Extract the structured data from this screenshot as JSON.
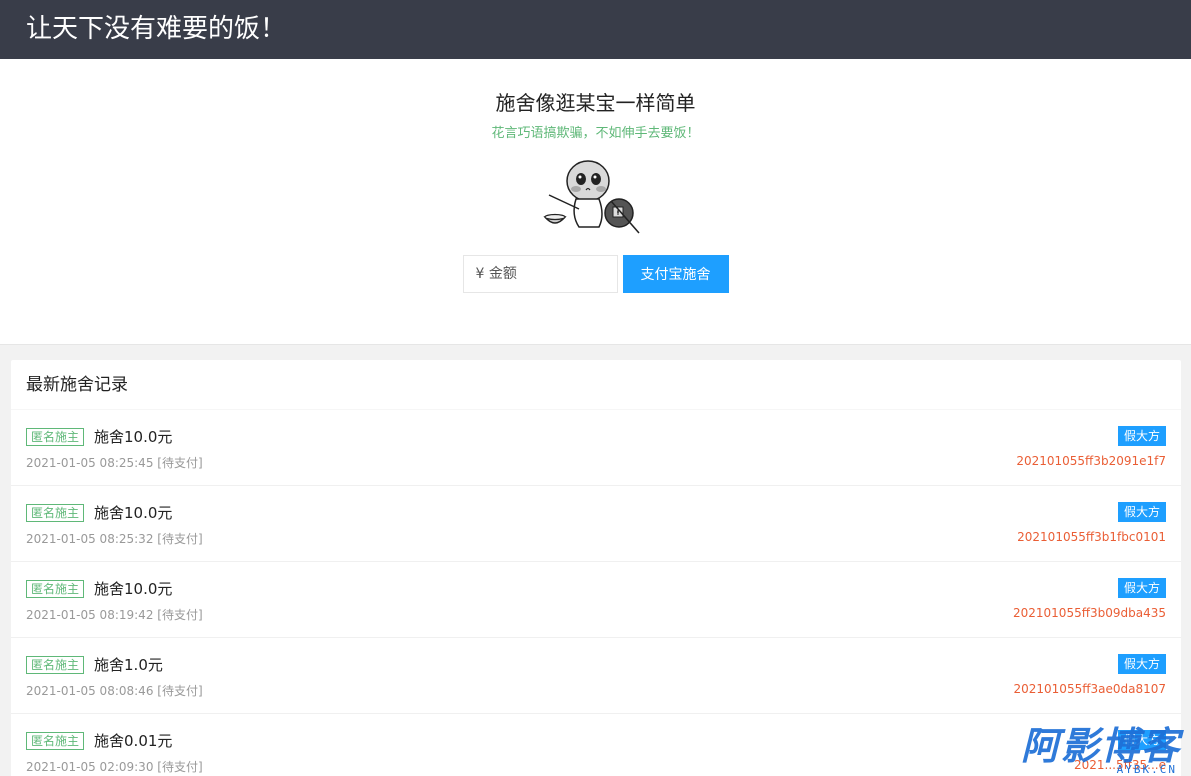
{
  "header": {
    "title": "让天下没有难要的饭！"
  },
  "hero": {
    "title": "施舍像逛某宝一样简单",
    "subtitle": "花言巧语搞欺骗，不如伸手去要饭！",
    "amount_placeholder": "¥ 金额",
    "pay_button": "支付宝施舍"
  },
  "records": {
    "title": "最新施舍记录",
    "items": [
      {
        "tag": "匿名施主",
        "amount": "施舍10.0元",
        "time": "2021-01-05 08:25:45 [待支付]",
        "badge": "假大方",
        "order": "202101055ff3b2091e1f7"
      },
      {
        "tag": "匿名施主",
        "amount": "施舍10.0元",
        "time": "2021-01-05 08:25:32 [待支付]",
        "badge": "假大方",
        "order": "202101055ff3b1fbc0101"
      },
      {
        "tag": "匿名施主",
        "amount": "施舍10.0元",
        "time": "2021-01-05 08:19:42 [待支付]",
        "badge": "假大方",
        "order": "202101055ff3b09dba435"
      },
      {
        "tag": "匿名施主",
        "amount": "施舍1.0元",
        "time": "2021-01-05 08:08:46 [待支付]",
        "badge": "假大方",
        "order": "202101055ff3ae0da8107"
      },
      {
        "tag": "匿名施主",
        "amount": "施舍0.01元",
        "time": "2021-01-05 02:09:30 [待支付]",
        "badge": "假大方",
        "order": "2021...5ff35...e"
      }
    ]
  },
  "watermark": {
    "text": "阿影博客",
    "sub": "AYBK.CN"
  },
  "colors": {
    "topbar": "#393d49",
    "accent_blue": "#1e9fff",
    "green": "#5fb878",
    "order_red": "#ea5e35"
  }
}
